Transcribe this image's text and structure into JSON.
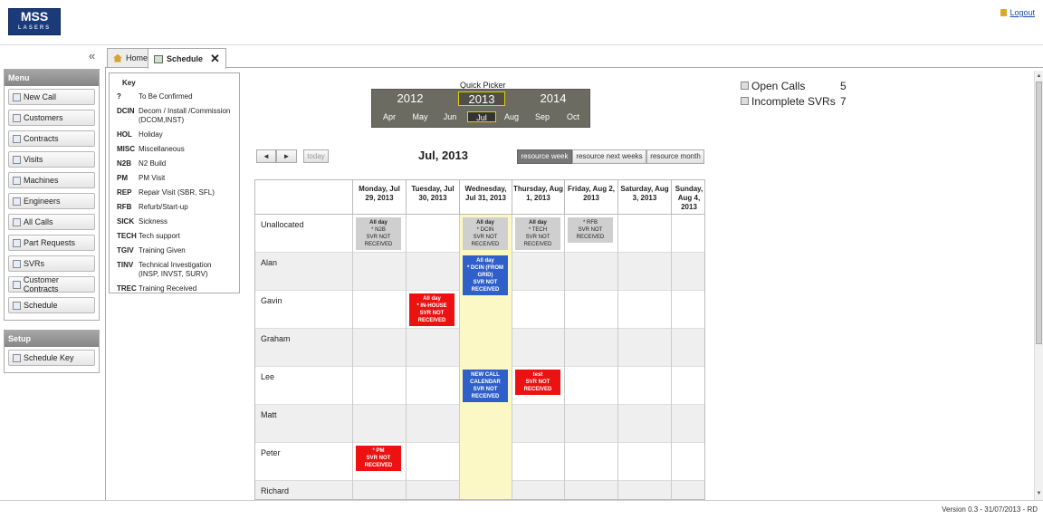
{
  "header": {
    "logo_line1": "MSS",
    "logo_line2": "LASERS",
    "logout_label": "Logout"
  },
  "sidebar": {
    "collapse_icon": "«",
    "menu_title": "Menu",
    "items": [
      {
        "label": "New Call",
        "icon": "new-call-icon"
      },
      {
        "label": "Customers",
        "icon": "customers-icon"
      },
      {
        "label": "Contracts",
        "icon": "contracts-icon"
      },
      {
        "label": "Visits",
        "icon": "visits-icon"
      },
      {
        "label": "Machines",
        "icon": "machines-icon"
      },
      {
        "label": "Engineers",
        "icon": "engineers-icon"
      },
      {
        "label": "All Calls",
        "icon": "all-calls-icon"
      },
      {
        "label": "Part Requests",
        "icon": "part-requests-icon"
      },
      {
        "label": "SVRs",
        "icon": "svrs-icon"
      },
      {
        "label": "Customer Contracts",
        "icon": "customer-contracts-icon"
      },
      {
        "label": "Schedule",
        "icon": "schedule-icon"
      }
    ],
    "setup_title": "Setup",
    "setup_items": [
      {
        "label": "Schedule Key",
        "icon": "schedule-key-icon"
      }
    ]
  },
  "tabs": [
    {
      "label": "Home",
      "icon": "home-icon",
      "active": false
    },
    {
      "label": "Schedule",
      "icon": "schedule-icon",
      "active": true
    }
  ],
  "key": {
    "title": "Key",
    "rows": [
      {
        "code": "?",
        "desc": "To Be Confirmed"
      },
      {
        "code": "DCIN",
        "desc": "Decom / Install /Commission (DCOM,INST)"
      },
      {
        "code": "HOL",
        "desc": "Holiday"
      },
      {
        "code": "MISC",
        "desc": "Miscellaneous"
      },
      {
        "code": "N2B",
        "desc": "N2 Build"
      },
      {
        "code": "PM",
        "desc": "PM Visit"
      },
      {
        "code": "REP",
        "desc": "Repair Visit (SBR, SFL)"
      },
      {
        "code": "RFB",
        "desc": "Refurb/Start-up"
      },
      {
        "code": "SICK",
        "desc": "Sickness"
      },
      {
        "code": "TECH",
        "desc": "Tech support"
      },
      {
        "code": "TGIV",
        "desc": "Training Given"
      },
      {
        "code": "TINV",
        "desc": "Technical Investigation (INSP, INVST, SURV)"
      },
      {
        "code": "TREC",
        "desc": "Training Received"
      }
    ]
  },
  "quick_picker": {
    "label": "Quick Picker",
    "years": [
      "2012",
      "2013",
      "2014"
    ],
    "selected_year": "2013",
    "months": [
      "Apr",
      "May",
      "Jun",
      "Jul",
      "Aug",
      "Sep",
      "Oct"
    ],
    "selected_month": "Jul"
  },
  "stats": {
    "open_calls_label": "Open Calls",
    "open_calls_value": "5",
    "incomplete_svrs_label": "Incomplete SVRs",
    "incomplete_svrs_value": "7"
  },
  "calendar": {
    "prev_label": "◄",
    "next_label": "►",
    "today_label": "today",
    "title": "Jul, 2013",
    "views": [
      {
        "label": "resource week",
        "active": true
      },
      {
        "label": "resource next weeks",
        "active": false
      },
      {
        "label": "resource month",
        "active": false
      }
    ],
    "days": [
      "Monday, Jul 29, 2013",
      "Tuesday, Jul 30, 2013",
      "Wednesday, Jul 31, 2013",
      "Thursday, Aug 1, 2013",
      "Friday, Aug 2, 2013",
      "Saturday, Aug 3, 2013",
      "Sunday, Aug 4, 2013"
    ],
    "resources": [
      "Unallocated",
      "Alan",
      "Gavin",
      "Graham",
      "Lee",
      "Matt",
      "Peter",
      "Richard"
    ],
    "events": [
      {
        "resource": 0,
        "day": 0,
        "color": "gray",
        "title": "All day",
        "lines": [
          "* N2B",
          "SVR NOT RECEIVED"
        ]
      },
      {
        "resource": 0,
        "day": 2,
        "color": "gray",
        "title": "All day",
        "lines": [
          "* DCIN",
          "SVR NOT RECEIVED"
        ]
      },
      {
        "resource": 0,
        "day": 3,
        "color": "gray",
        "title": "All day",
        "lines": [
          "* TECH",
          "SVR NOT RECEIVED"
        ]
      },
      {
        "resource": 0,
        "day": 4,
        "color": "gray",
        "title": "",
        "lines": [
          "* RFB",
          "SVR NOT RECEIVED"
        ]
      },
      {
        "resource": 1,
        "day": 2,
        "color": "blue",
        "title": "All day",
        "lines": [
          "* DCIN (FROM GRID)",
          "SVR NOT RECEIVED"
        ]
      },
      {
        "resource": 2,
        "day": 1,
        "color": "red",
        "title": "All day",
        "lines": [
          "* IN-HOUSE",
          "SVR NOT RECEIVED"
        ]
      },
      {
        "resource": 4,
        "day": 2,
        "color": "blue",
        "title": "",
        "lines": [
          "NEW CALL CALENDAR",
          "SVR NOT RECEIVED"
        ]
      },
      {
        "resource": 4,
        "day": 3,
        "color": "red",
        "title": "test",
        "lines": [
          "SVR NOT RECEIVED"
        ]
      },
      {
        "resource": 6,
        "day": 0,
        "color": "red",
        "title": "",
        "lines": [
          "* PM",
          "SVR NOT RECEIVED"
        ]
      }
    ]
  },
  "footer": {
    "version": "Version 0.3 - 31/07/2013 - RD"
  }
}
